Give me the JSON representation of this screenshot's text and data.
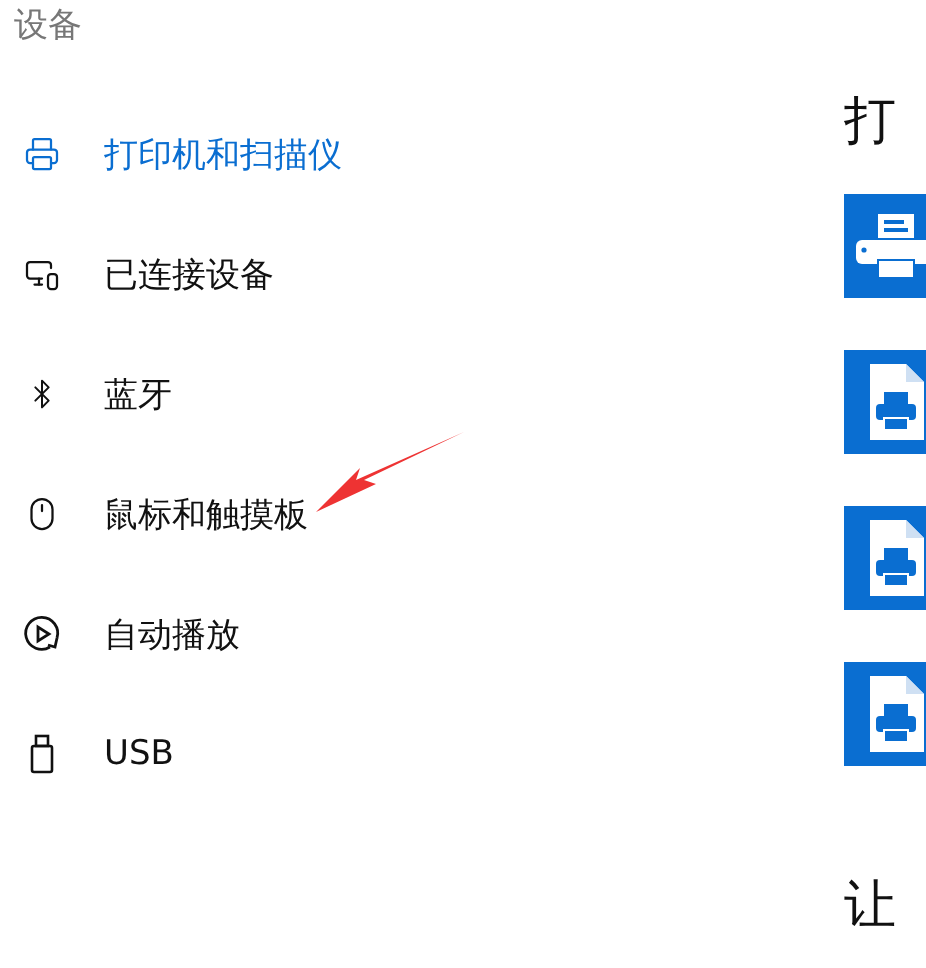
{
  "sidebar": {
    "title": "设备",
    "items": [
      {
        "label": "打印机和扫描仪",
        "kind": "printer",
        "selected": true
      },
      {
        "label": "已连接设备",
        "kind": "devices",
        "selected": false
      },
      {
        "label": "蓝牙",
        "kind": "bluetooth",
        "selected": false
      },
      {
        "label": "鼠标和触摸板",
        "kind": "mouse",
        "selected": false
      },
      {
        "label": "自动播放",
        "kind": "autoplay",
        "selected": false
      },
      {
        "label": "USB",
        "kind": "usb",
        "selected": false
      }
    ]
  },
  "content": {
    "heading": "打",
    "devices": [
      {
        "kind": "printer"
      },
      {
        "kind": "document"
      },
      {
        "kind": "document"
      },
      {
        "kind": "document"
      }
    ],
    "next_heading": "让"
  }
}
